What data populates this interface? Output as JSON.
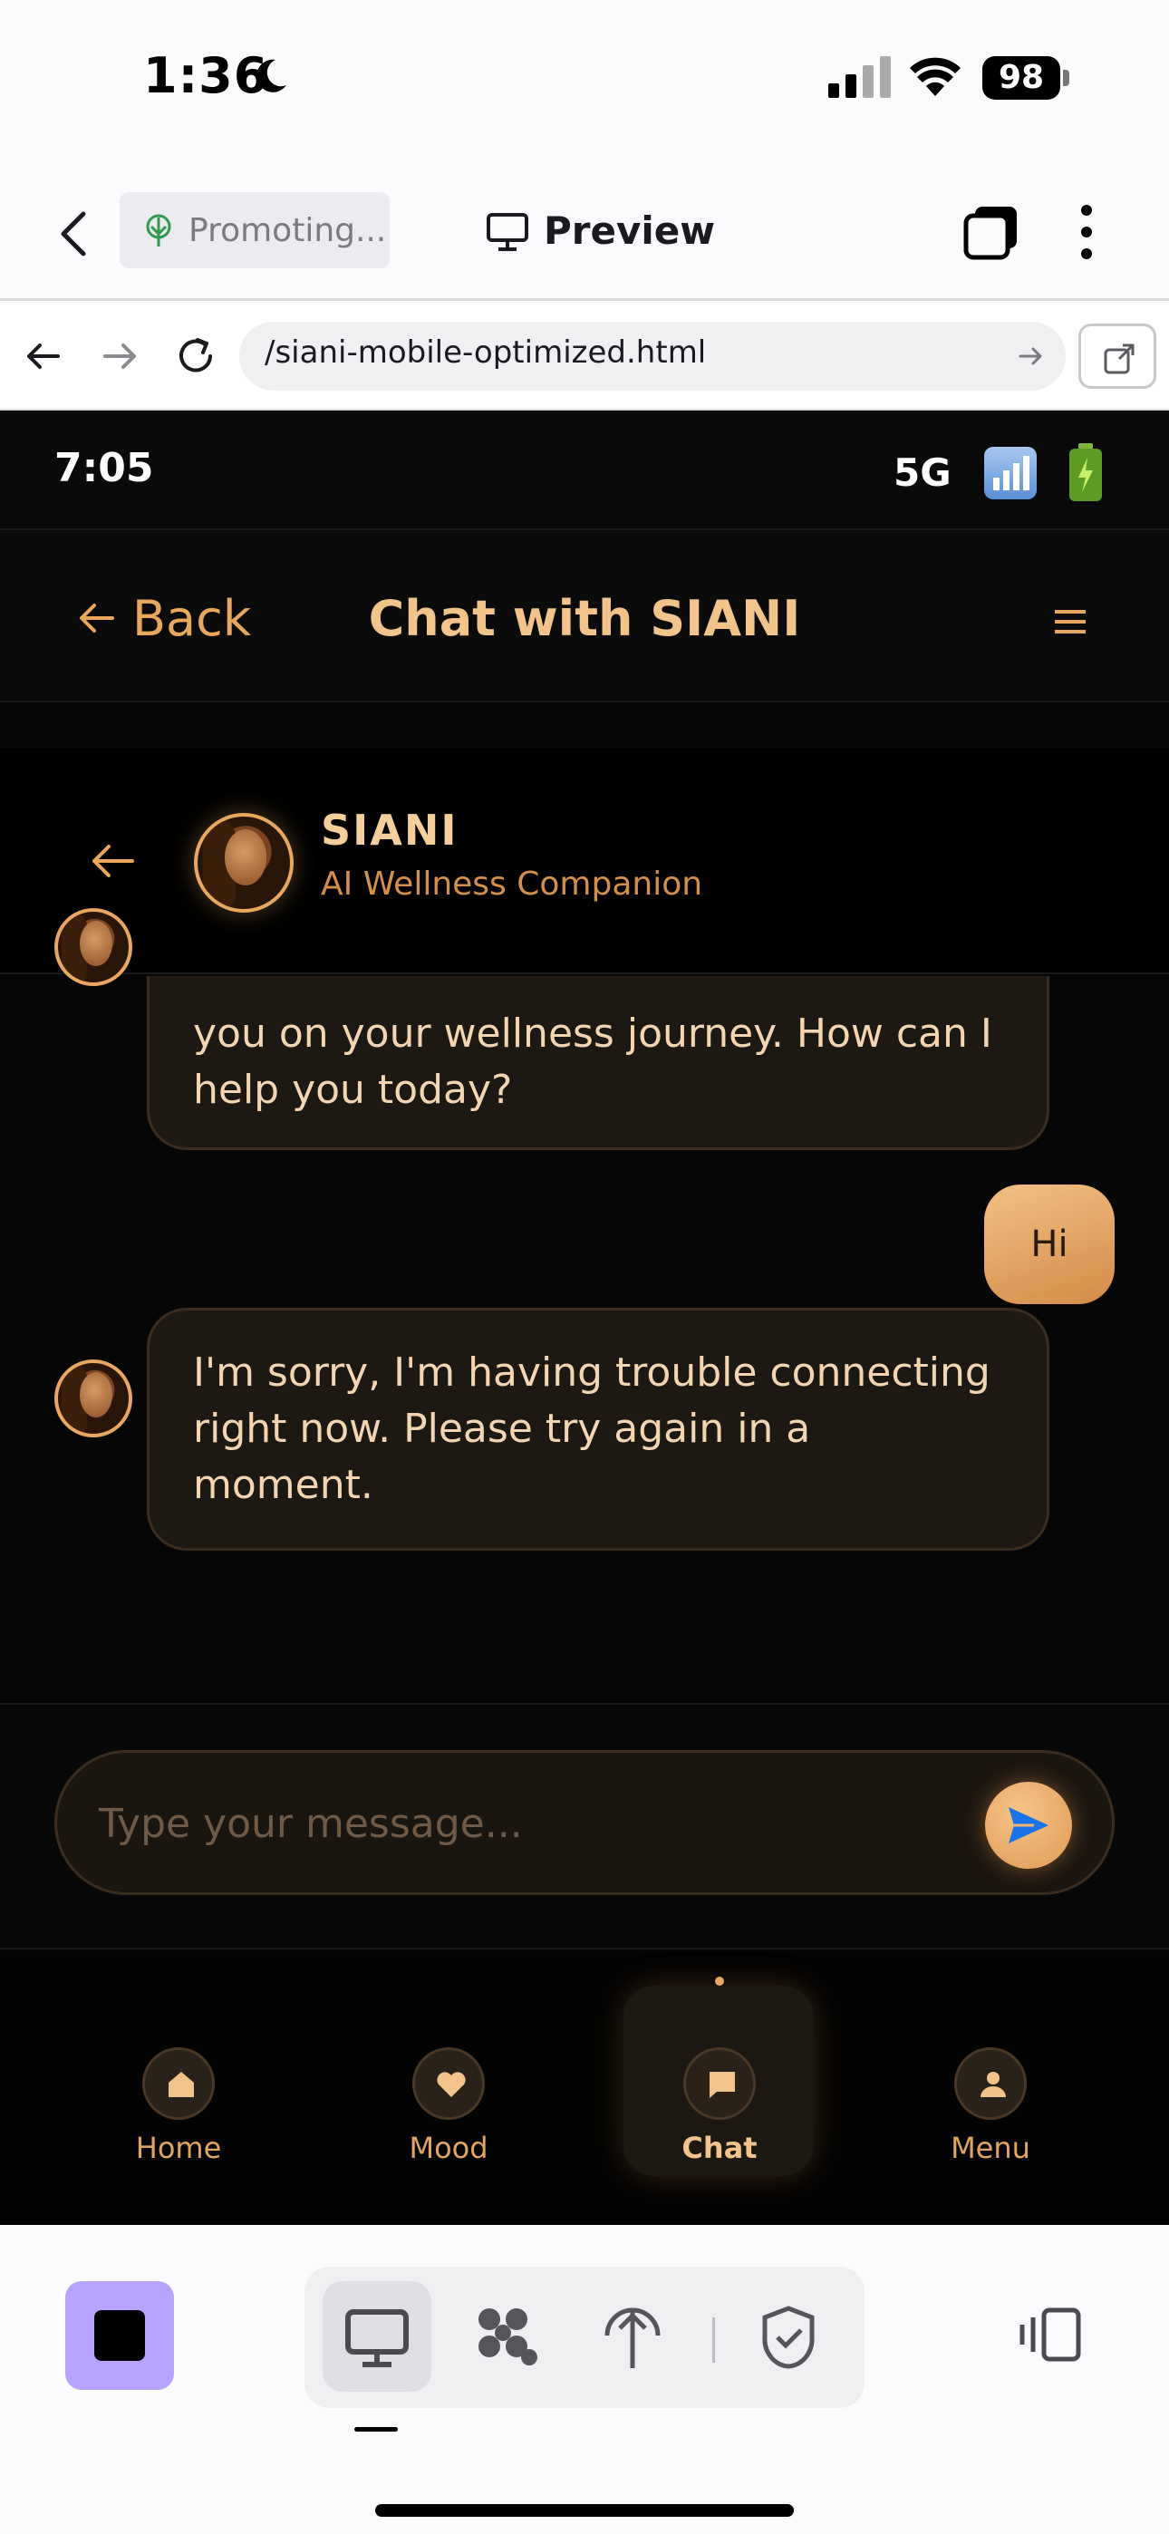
{
  "ios_status": {
    "time": "1:36",
    "battery": "98"
  },
  "browser": {
    "promo_label": "Promoting...",
    "preview_label": "Preview",
    "url": "/siani-mobile-optimized.html"
  },
  "app": {
    "status": {
      "time": "7:05",
      "network": "5G"
    },
    "header": {
      "back_label": "Back",
      "title": "Chat with SIANI"
    },
    "companion": {
      "name": "SIANI",
      "subtitle": "AI Wellness Companion"
    },
    "messages": [
      {
        "sender": "ai",
        "text": "you on your wellness journey. How can I help you today?"
      },
      {
        "sender": "user",
        "text": "Hi"
      },
      {
        "sender": "ai",
        "text": "I'm sorry, I'm having trouble connecting right now. Please try again in a moment."
      }
    ],
    "input": {
      "placeholder": "Type your message..."
    },
    "nav": [
      {
        "label": "Home",
        "icon": "home-icon",
        "active": false
      },
      {
        "label": "Mood",
        "icon": "heart-icon",
        "active": false
      },
      {
        "label": "Chat",
        "icon": "chat-icon",
        "active": true
      },
      {
        "label": "Menu",
        "icon": "user-icon",
        "active": false
      }
    ]
  },
  "colors": {
    "accent": "#e9a762",
    "background": "#060606",
    "send_arrow": "#1a73e8"
  }
}
